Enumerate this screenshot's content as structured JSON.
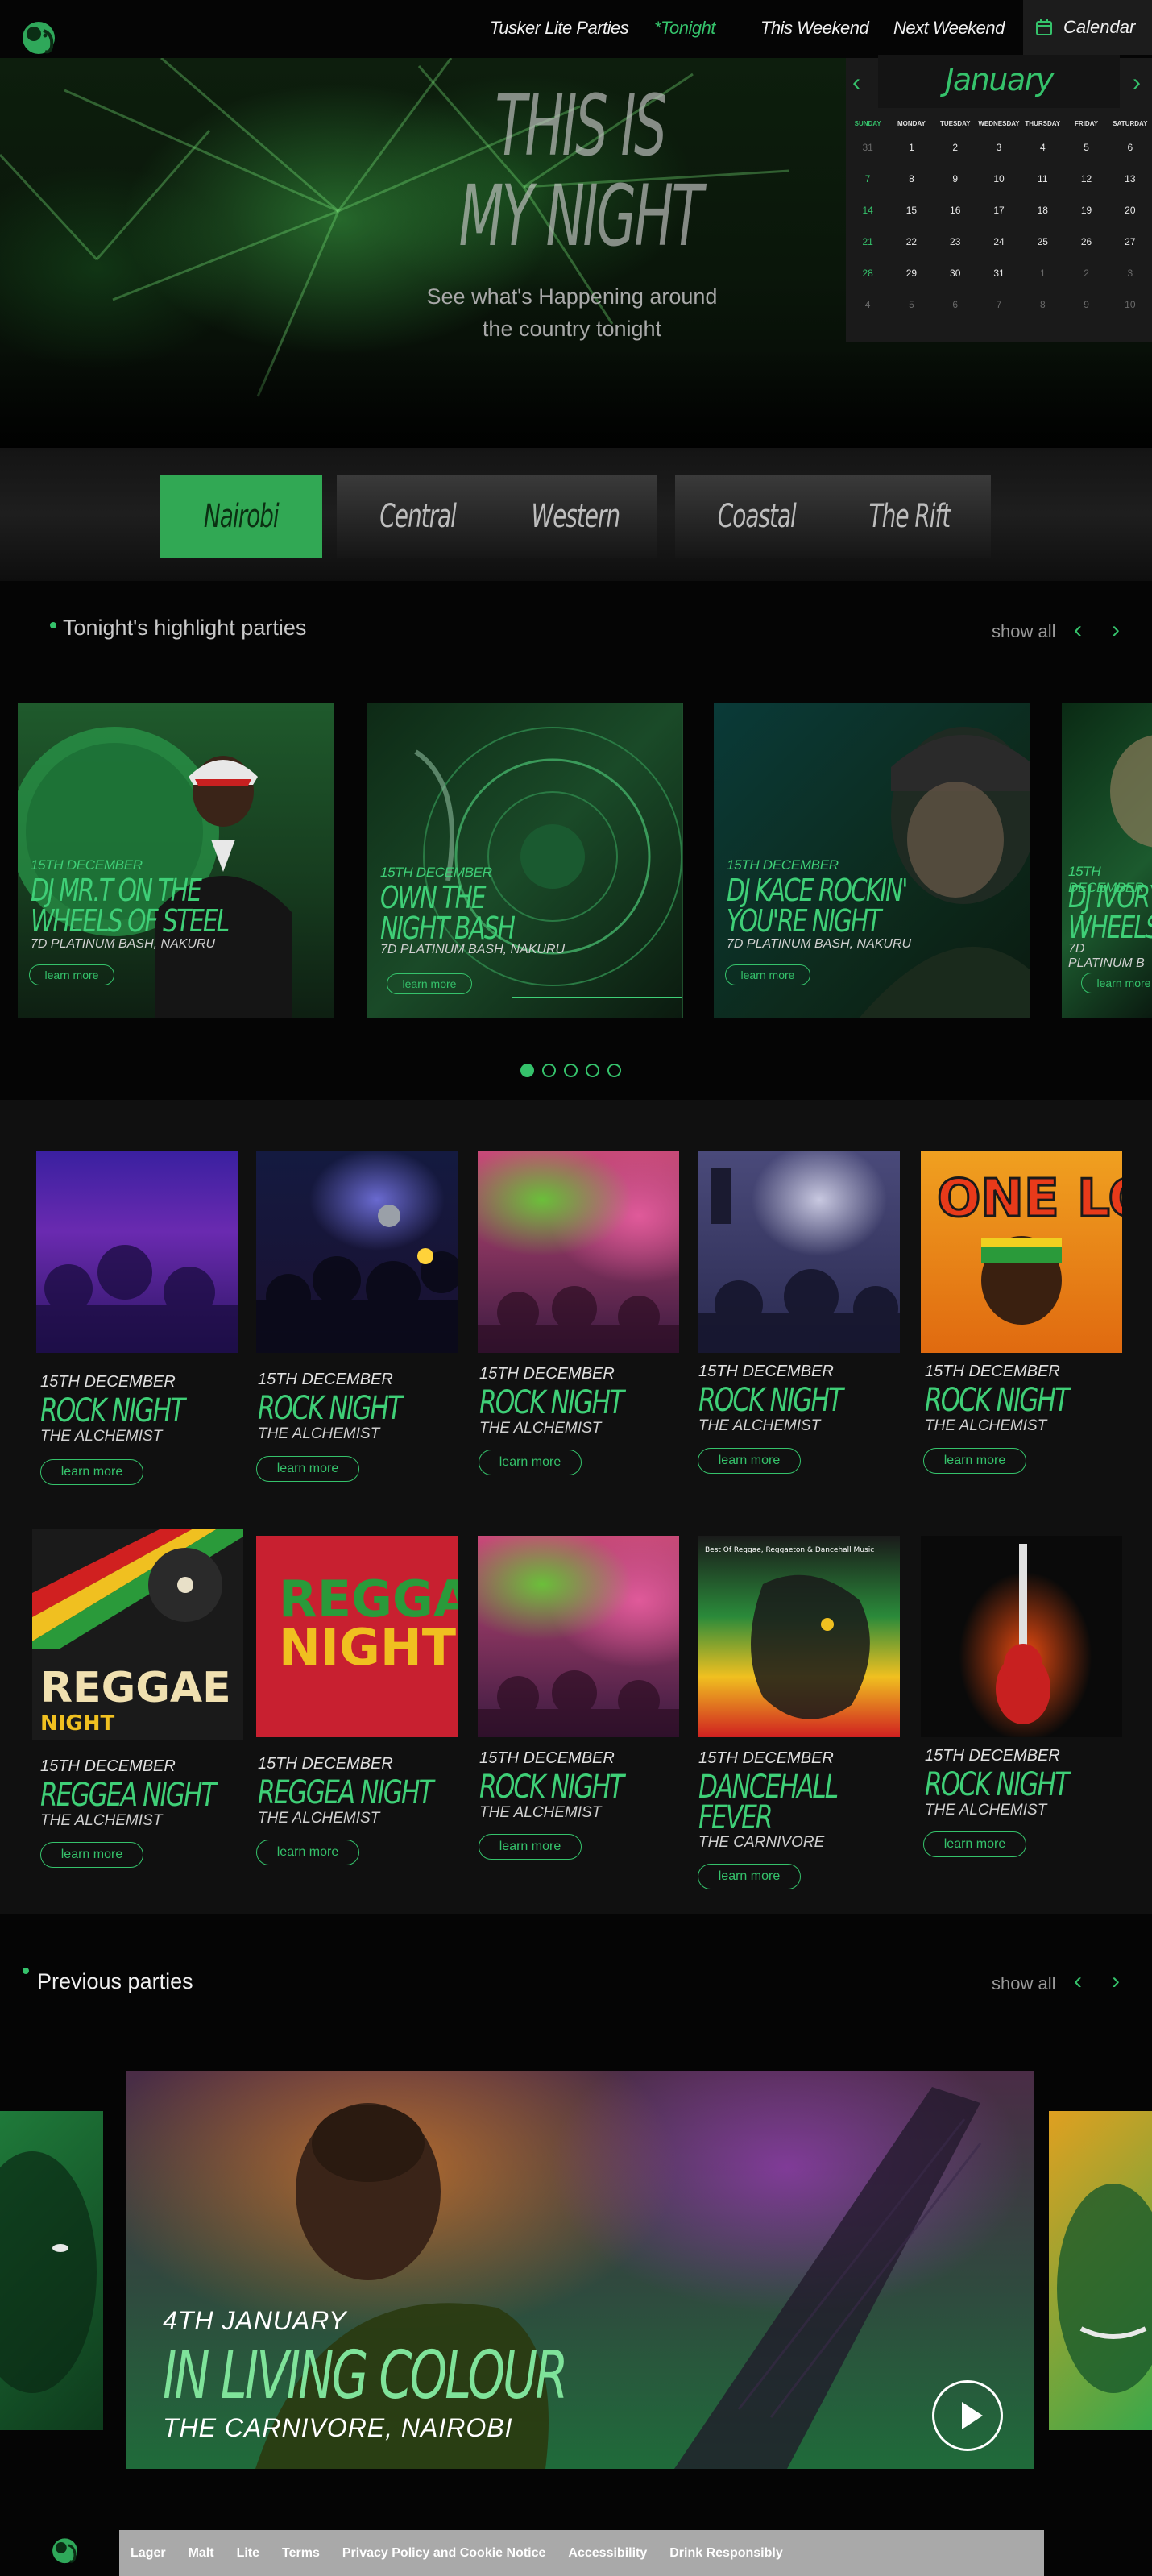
{
  "brand": {
    "accent": "#35c26b",
    "dark": "#050505"
  },
  "nav": {
    "items": [
      {
        "label": "Tusker Lite Parties",
        "active": false
      },
      {
        "label": "*Tonight",
        "active": true
      },
      {
        "label": "This Weekend",
        "active": false
      },
      {
        "label": "Next Weekend",
        "active": false
      }
    ],
    "calendar_label": "Calendar"
  },
  "hero": {
    "title_line1": "THIS IS",
    "title_line2": "MY NIGHT",
    "subtitle_line1": "See what's Happening around",
    "subtitle_line2": "the country tonight"
  },
  "calendar": {
    "month": "January",
    "weekdays": [
      "Sunday",
      "Monday",
      "Tuesday",
      "Wednesday",
      "Thursday",
      "Friday",
      "Saturday"
    ],
    "days": [
      "31",
      "1",
      "2",
      "3",
      "4",
      "5",
      "6",
      "7",
      "8",
      "9",
      "10",
      "11",
      "12",
      "13",
      "14",
      "15",
      "16",
      "17",
      "18",
      "19",
      "20",
      "21",
      "22",
      "23",
      "24",
      "25",
      "26",
      "27",
      "28",
      "29",
      "30",
      "31",
      "1",
      "2",
      "3",
      "4",
      "5",
      "6",
      "7",
      "8",
      "9",
      "10"
    ],
    "dim_indices": [
      0,
      32,
      33,
      34,
      35,
      36,
      37,
      38,
      39,
      40,
      41
    ]
  },
  "regions": [
    "Nairobi",
    "Central",
    "Western",
    "Coastal",
    "The Rift"
  ],
  "highlights": {
    "title": "Tonight's highlight parties",
    "show_all": "show all",
    "cards": [
      {
        "date": "15th December",
        "title_l1": "DJ MR.T ON THE",
        "title_l2": "WHEELS OF STEEL",
        "venue": "7D Platinum Bash, Nakuru",
        "cta": "learn more"
      },
      {
        "date": "15th December",
        "title_l1": "OWN THE",
        "title_l2": "NIGHT BASH",
        "venue": "7D Platinum Bash, Nakuru",
        "cta": "learn more"
      },
      {
        "date": "15th December",
        "title_l1": "DJ KACE ROCKIN'",
        "title_l2": "YOU'RE NIGHT",
        "venue": "7D Platinum Bash, Nakuru",
        "cta": "learn more"
      },
      {
        "date": "15th December",
        "title_l1": "DJ IVORY",
        "title_l2": "WHEELS",
        "venue": "7D Platinum B",
        "cta": "learn more"
      }
    ]
  },
  "events": [
    {
      "date": "15th December",
      "title": "ROCK NIGHT",
      "venue": "THE ALCHEMIST",
      "cta": "learn more"
    },
    {
      "date": "15th December",
      "title": "ROCK NIGHT",
      "venue": "THE ALCHEMIST",
      "cta": "learn more"
    },
    {
      "date": "15th December",
      "title": "ROCK NIGHT",
      "venue": "THE ALCHEMIST",
      "cta": "learn more"
    },
    {
      "date": "15th December",
      "title": "ROCK NIGHT",
      "venue": "THE ALCHEMIST",
      "cta": "learn more"
    },
    {
      "date": "15th December",
      "title": "ROCK NIGHT",
      "venue": "THE ALCHEMIST",
      "cta": "learn more"
    },
    {
      "date": "15th December",
      "title": "REGGEA NIGHT",
      "venue": "THE ALCHEMIST",
      "cta": "learn more"
    },
    {
      "date": "15th December",
      "title": "REGGEA NIGHT",
      "venue": "THE ALCHEMIST",
      "cta": "learn more"
    },
    {
      "date": "15th December",
      "title": "ROCK NIGHT",
      "venue": "THE ALCHEMIST",
      "cta": "learn more"
    },
    {
      "date": "15th December",
      "title": "DANCEHALL",
      "title2": "FEVER",
      "venue": "THE CARNIVORE",
      "cta": "learn more"
    },
    {
      "date": "15th December",
      "title": "ROCK NIGHT",
      "venue": "THE ALCHEMIST",
      "cta": "learn more"
    }
  ],
  "poster_text": {
    "one_love": "ONE LOVE",
    "reggae": "REGGAE",
    "night": "NIGHT",
    "reggae_night_1": "REGGAE",
    "reggae_night_2": "NIGHT",
    "lion_caption": "Best Of Reggae, Reggaeton & Dancehall Music"
  },
  "previous": {
    "title": "Previous parties",
    "show_all": "show all",
    "slide": {
      "date": "4TH JANUARY",
      "title": "IN LIVING COLOUR",
      "venue": "THE CARNIVORE, NAIROBI"
    }
  },
  "footer": {
    "links": [
      "Lager",
      "Malt",
      "Lite",
      "Terms",
      "Privacy Policy and Cookie Notice",
      "Accessibility",
      "Drink Responsibly"
    ]
  }
}
